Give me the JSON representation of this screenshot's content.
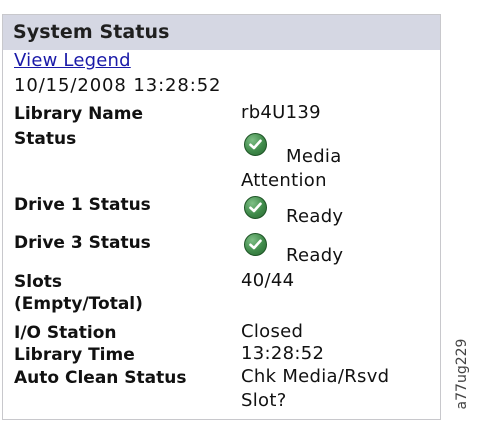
{
  "panel": {
    "title": "System Status",
    "legend_link": "View Legend",
    "timestamp": "10/15/2008 13:28:52"
  },
  "fields": {
    "library_name": {
      "label": "Library Name",
      "value": "rb4U139"
    },
    "status": {
      "label": "Status",
      "icon": "check-circle-icon",
      "value_line1": "Media",
      "value_line2": "Attention"
    },
    "drive1": {
      "label": "Drive 1 Status",
      "icon": "check-circle-icon",
      "value": "Ready"
    },
    "drive3": {
      "label": "Drive 3 Status",
      "icon": "check-circle-icon",
      "value": "Ready"
    },
    "slots": {
      "label_line1": "Slots",
      "label_line2": "(Empty/Total)",
      "value": "40/44"
    },
    "io_station": {
      "label": "I/O Station",
      "value": "Closed"
    },
    "library_time": {
      "label": "Library Time",
      "value": "13:28:52"
    },
    "auto_clean": {
      "label": "Auto Clean Status",
      "value_line1": "Chk Media/Rsvd",
      "value_line2": "Slot?"
    }
  },
  "figure_id": "a77ug229",
  "colors": {
    "header_bg": "#d5d7e3",
    "link": "#1a1aa8",
    "status_ok": "#3f8a4a"
  }
}
